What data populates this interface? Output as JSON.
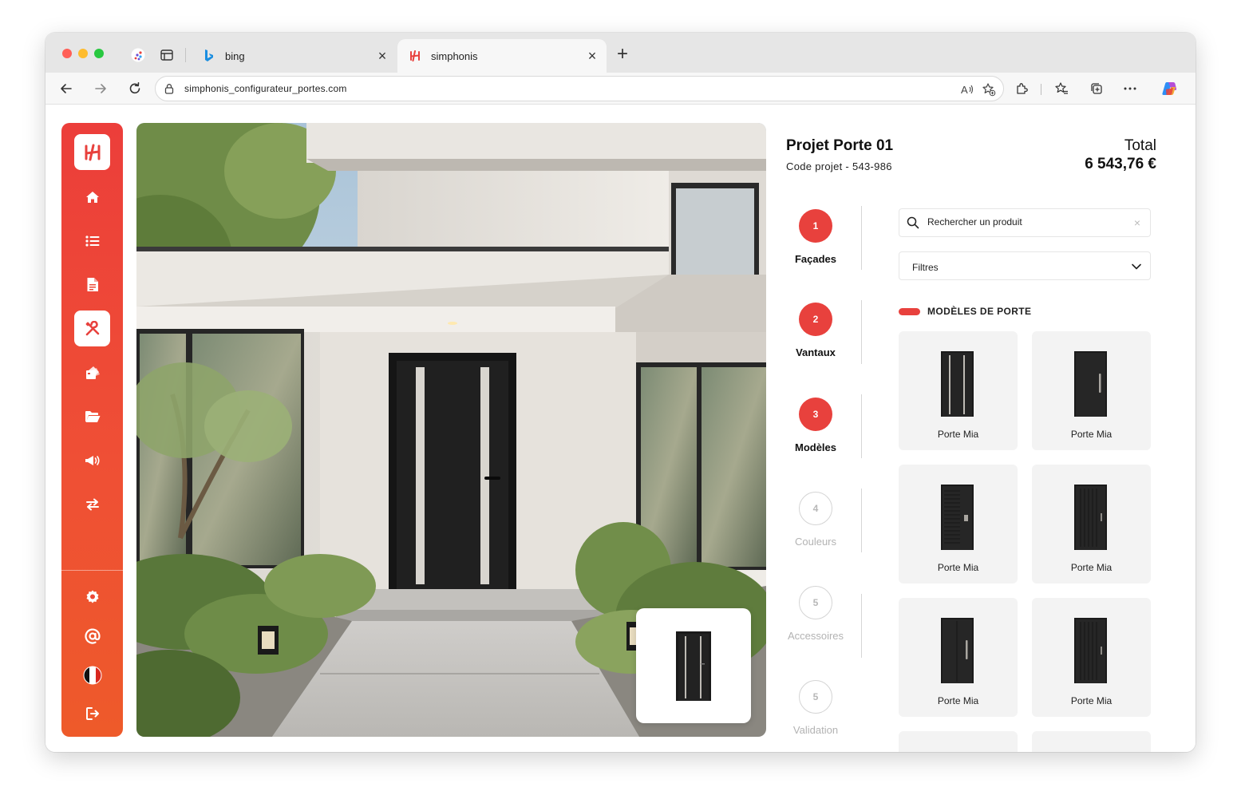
{
  "browser": {
    "tabs": [
      {
        "title": "bing",
        "icon": "bing-icon",
        "active": false
      },
      {
        "title": "simphonis",
        "icon": "simphonis-favicon",
        "active": true
      }
    ],
    "url": "simphonis_configurateur_portes.com"
  },
  "sidebar": {
    "items": [
      {
        "icon": "home-icon"
      },
      {
        "icon": "list-icon"
      },
      {
        "icon": "document-icon"
      },
      {
        "icon": "tools-icon",
        "active": true
      },
      {
        "icon": "swatch-icon"
      },
      {
        "icon": "folder-icon"
      },
      {
        "icon": "megaphone-icon"
      },
      {
        "icon": "swap-icon"
      }
    ],
    "bottom_items": [
      {
        "icon": "settings-icon"
      },
      {
        "icon": "at-icon"
      },
      {
        "icon": "french-flag-icon"
      },
      {
        "icon": "logout-icon"
      }
    ]
  },
  "project": {
    "title": "Projet Porte 01",
    "code": "Code projet - 543-986",
    "total_label": "Total",
    "total_value": "6 543,76 €"
  },
  "steps": [
    {
      "number": "1",
      "label": "Façades",
      "state": "done"
    },
    {
      "number": "2",
      "label": "Vantaux",
      "state": "done"
    },
    {
      "number": "3",
      "label": "Modèles",
      "state": "done"
    },
    {
      "number": "4",
      "label": "Couleurs",
      "state": "todo"
    },
    {
      "number": "5",
      "label": "Accessoires",
      "state": "todo"
    },
    {
      "number": "5",
      "label": "Validation",
      "state": "todo"
    }
  ],
  "search": {
    "placeholder": "Rechercher un produit"
  },
  "filters": {
    "label": "Filtres"
  },
  "models": {
    "section_title": "MODÈLES DE PORTE",
    "items": [
      {
        "name": "Porte Mia",
        "style": "double-strip"
      },
      {
        "name": "Porte Mia",
        "style": "right-handle"
      },
      {
        "name": "Porte Mia",
        "style": "horizontal-slats"
      },
      {
        "name": "Porte Mia",
        "style": "vertical-grooves"
      },
      {
        "name": "Porte Mia",
        "style": "right-handle"
      },
      {
        "name": "Porte Mia",
        "style": "vertical-grooves"
      }
    ]
  },
  "colors": {
    "brand": "#e8413d",
    "brand_gradient_end": "#ee5a2a",
    "door": "#1f1f1f"
  }
}
